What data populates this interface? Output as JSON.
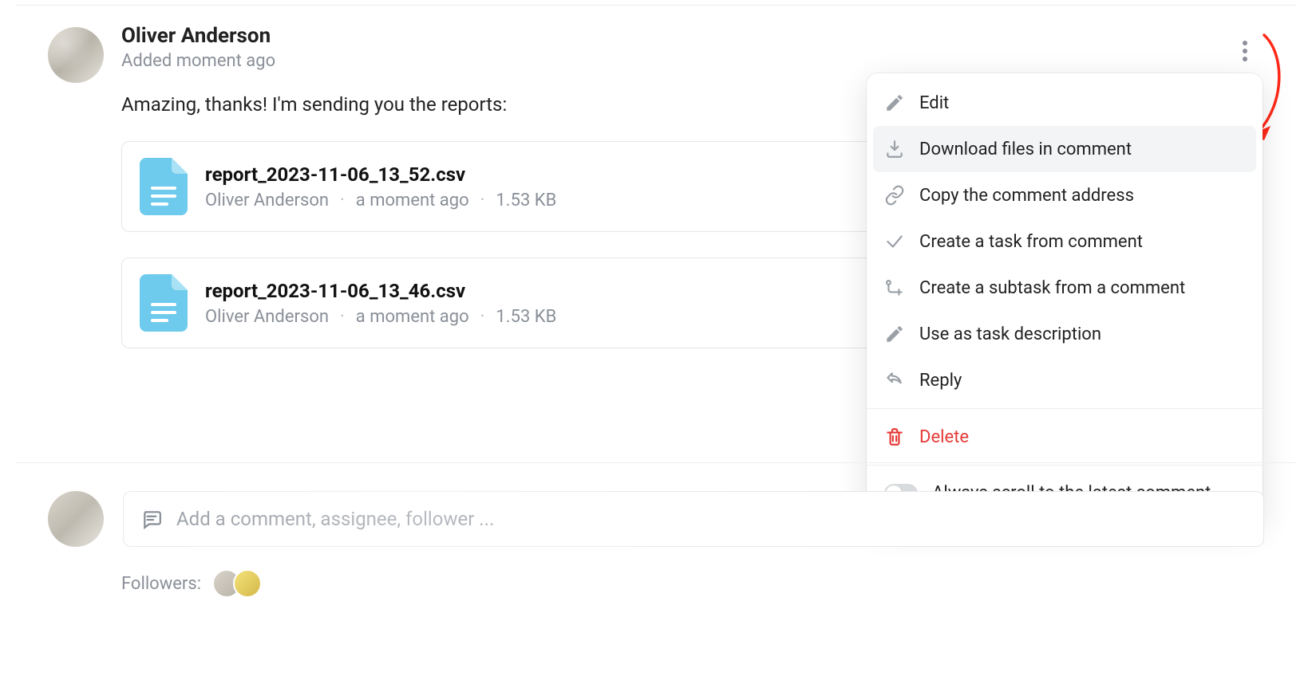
{
  "comment": {
    "author": "Oliver Anderson",
    "timestamp": "Added moment ago",
    "body": "Amazing, thanks! I'm sending you the reports:",
    "attachments": [
      {
        "filename": "report_2023-11-06_13_52.csv",
        "uploader": "Oliver Anderson",
        "when": "a moment ago",
        "size": "1.53 KB"
      },
      {
        "filename": "report_2023-11-06_13_46.csv",
        "uploader": "Oliver Anderson",
        "when": "a moment ago",
        "size": "1.53 KB"
      }
    ]
  },
  "menu": {
    "edit": "Edit",
    "download": "Download files in comment",
    "copy": "Copy the comment address",
    "create_task": "Create a task from comment",
    "create_subtask": "Create a subtask from a comment",
    "use_desc": "Use as task description",
    "reply": "Reply",
    "delete": "Delete",
    "scroll_setting": "Always scroll to the latest comment"
  },
  "compose": {
    "placeholder": "Add a comment, assignee, follower ..."
  },
  "followers": {
    "label": "Followers:"
  }
}
